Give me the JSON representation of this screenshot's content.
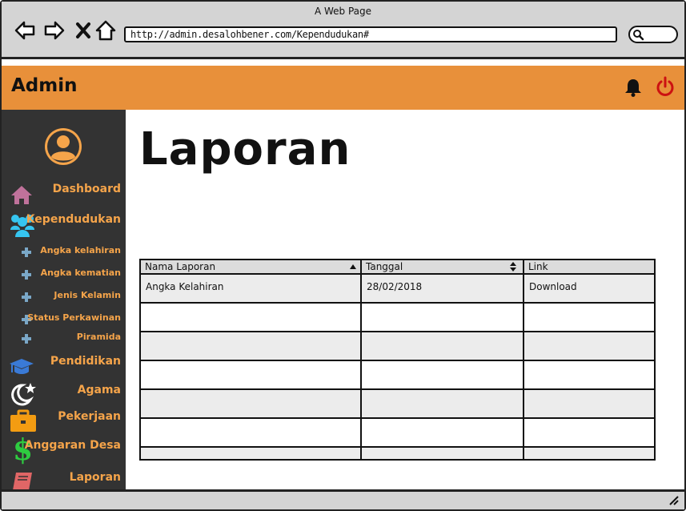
{
  "browser": {
    "window_title": "A Web Page",
    "url": "http://admin.desalohbener.com/Kependudukan#"
  },
  "header": {
    "brand": "Admin"
  },
  "sidebar": {
    "items": [
      {
        "label": "Dashboard",
        "icon": "home-icon",
        "color": "#c0729b"
      },
      {
        "label": "Kependudukan",
        "icon": "users-icon",
        "color": "#36c5f0"
      },
      {
        "label": "Angka kelahiran",
        "icon": "plus-icon",
        "color": "#7aa7c7"
      },
      {
        "label": "Angka kematian",
        "icon": "plus-icon",
        "color": "#7aa7c7"
      },
      {
        "label": "Jenis Kelamin",
        "icon": "plus-icon",
        "color": "#7aa7c7"
      },
      {
        "label": "Status Perkawinan",
        "icon": "plus-icon",
        "color": "#7aa7c7"
      },
      {
        "label": "Piramida",
        "icon": "plus-icon",
        "color": "#7aa7c7"
      },
      {
        "label": "Pendidikan",
        "icon": "graduation-cap-icon",
        "color": "#3a7ad6"
      },
      {
        "label": "Agama",
        "icon": "moon-star-icon",
        "color": "#ffffff"
      },
      {
        "label": "Pekerjaan",
        "icon": "briefcase-icon",
        "color": "#f39c12"
      },
      {
        "label": "Anggaran Desa",
        "icon": "dollar-icon",
        "color": "#2ecc40"
      },
      {
        "label": "Laporan",
        "icon": "book-icon",
        "color": "#e06666"
      }
    ]
  },
  "main": {
    "title": "Laporan",
    "table": {
      "columns": [
        "Nama Laporan",
        "Tanggal",
        "Link"
      ],
      "rows": [
        [
          "Angka Kelahiran",
          "28/02/2018",
          "Download"
        ],
        [
          "",
          "",
          ""
        ],
        [
          "",
          "",
          ""
        ],
        [
          "",
          "",
          ""
        ],
        [
          "",
          "",
          ""
        ],
        [
          "",
          "",
          ""
        ]
      ]
    }
  },
  "colors": {
    "topbar": "#e8903a",
    "sidebar_bg": "#333333",
    "sidebar_text": "#f5a44a",
    "power": "#cc1111"
  }
}
